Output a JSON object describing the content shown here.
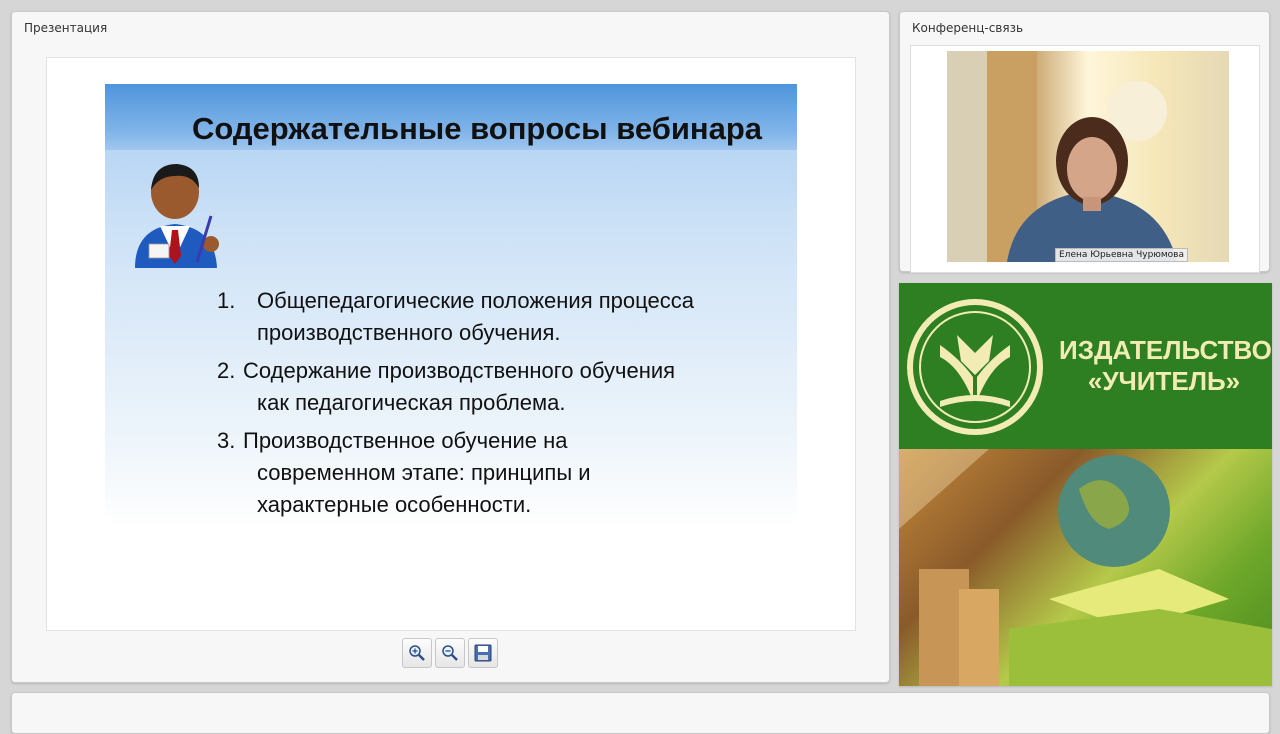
{
  "presentation_panel": {
    "title": "Презентация",
    "slide": {
      "title": "Содержательные вопросы вебинара",
      "items": [
        {
          "num": "1.",
          "line1": "Общепедагогические положения процесса",
          "line2": "производственного обучения."
        },
        {
          "num": "2.",
          "line1": "Содержание производственного обучения",
          "line2": "как педагогическая проблема."
        },
        {
          "num": "3.",
          "line1": "Производственное обучение на",
          "line2": "современном этапе: принципы и",
          "line3": "характерные особенности."
        }
      ]
    },
    "toolbar": {
      "zoom_in_icon": "zoom-in-icon",
      "zoom_out_icon": "zoom-out-icon",
      "save_icon": "save-icon"
    }
  },
  "conference_panel": {
    "title": "Конференц-связь",
    "speaker_name": "Елена Юрьевна Чурюмова"
  },
  "promo": {
    "line1": "ИЗДАТЕЛЬСТВО",
    "line2": "«УЧИТЕЛЬ»"
  },
  "colors": {
    "promo_green": "#2e7f22",
    "promo_text": "#f2ecb4",
    "slide_band": "#4f95dc"
  }
}
